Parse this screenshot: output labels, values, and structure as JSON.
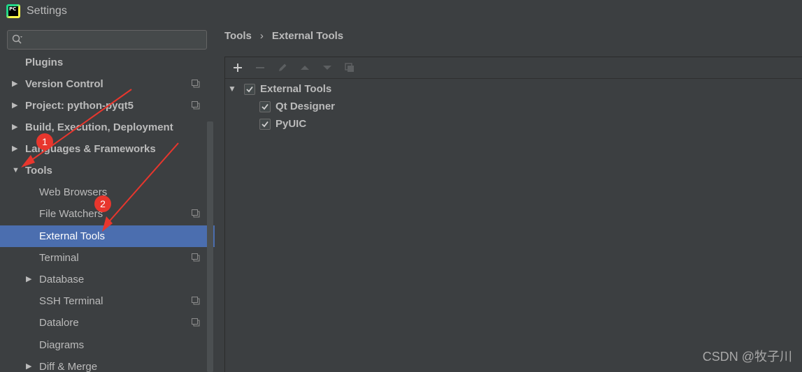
{
  "window": {
    "title": "Settings",
    "app_icon": "pycharm-logo",
    "app_icon_text": "PC"
  },
  "sidebar": {
    "search": {
      "placeholder": "",
      "value": ""
    },
    "items": [
      {
        "label": "Plugins",
        "bold": true,
        "arrow": "",
        "copy": false
      },
      {
        "label": "Version Control",
        "bold": true,
        "arrow": "collapsed",
        "copy": true
      },
      {
        "label": "Project: python-pyqt5",
        "bold": true,
        "arrow": "collapsed",
        "copy": true
      },
      {
        "label": "Build, Execution, Deployment",
        "bold": true,
        "arrow": "collapsed",
        "copy": false
      },
      {
        "label": "Languages & Frameworks",
        "bold": true,
        "arrow": "collapsed",
        "copy": false
      },
      {
        "label": "Tools",
        "bold": true,
        "arrow": "expanded",
        "copy": false
      },
      {
        "label": "Web Browsers",
        "bold": false,
        "arrow": "",
        "copy": false
      },
      {
        "label": "File Watchers",
        "bold": false,
        "arrow": "",
        "copy": true
      },
      {
        "label": "External Tools",
        "bold": false,
        "arrow": "",
        "copy": false,
        "selected": true
      },
      {
        "label": "Terminal",
        "bold": false,
        "arrow": "",
        "copy": true
      },
      {
        "label": "Database",
        "bold": false,
        "arrow": "collapsed",
        "copy": false
      },
      {
        "label": "SSH Terminal",
        "bold": false,
        "arrow": "",
        "copy": true
      },
      {
        "label": "Datalore",
        "bold": false,
        "arrow": "",
        "copy": true
      },
      {
        "label": "Diagrams",
        "bold": false,
        "arrow": "",
        "copy": false
      },
      {
        "label": "Diff & Merge",
        "bold": false,
        "arrow": "collapsed",
        "copy": false
      }
    ]
  },
  "main": {
    "breadcrumb": [
      "Tools",
      "External Tools"
    ],
    "breadcrumb_separator": "›",
    "toolbar": {
      "buttons": [
        {
          "icon": "plus-icon",
          "enabled": true
        },
        {
          "icon": "minus-icon",
          "enabled": false
        },
        {
          "icon": "edit-icon",
          "enabled": false
        },
        {
          "icon": "move-up-icon",
          "enabled": false
        },
        {
          "icon": "move-down-icon",
          "enabled": false
        },
        {
          "icon": "copy-icon",
          "enabled": false
        }
      ]
    },
    "tree": {
      "group": {
        "label": "External Tools",
        "checked": true,
        "expanded": true
      },
      "children": [
        {
          "label": "Qt Designer",
          "checked": true
        },
        {
          "label": "PyUIC",
          "checked": true
        }
      ]
    }
  },
  "annotations": {
    "badge1": "1",
    "badge2": "2",
    "color": "#e8362d"
  },
  "watermark": "CSDN @牧子川"
}
